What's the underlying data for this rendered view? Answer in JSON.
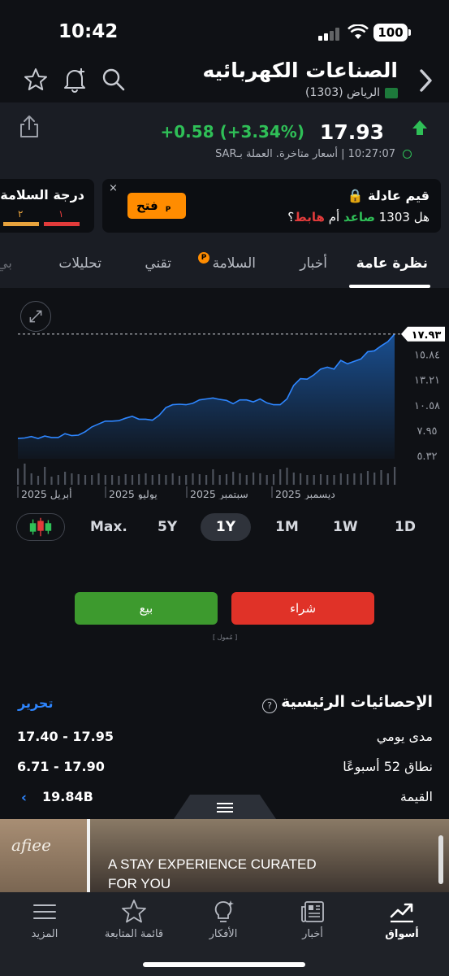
{
  "status_bar": {
    "time": "10:42",
    "battery": "100"
  },
  "header": {
    "title": "الصناعات الكهربائيه",
    "exchange": "الرياض (1303)"
  },
  "quote": {
    "price": "17.93",
    "change": "+0.58 (+3.34%)",
    "meta": "10:27:07 | أسعار متاخرة. العملة بـSAR",
    "direction_color": "#2fbf57"
  },
  "fair_value_card": {
    "title": "قيم عادلة",
    "question_prefix": "هل 1303",
    "up_word": "صاعد",
    "or_word": "أم",
    "down_word": "هابط",
    "question_suffix": "؟",
    "open_button": "فتح",
    "close": "×"
  },
  "safety_card": {
    "title": "درجة السلامة",
    "scores": [
      "١",
      "٢"
    ]
  },
  "tabs": [
    {
      "label": "نظرة عامة",
      "active": true
    },
    {
      "label": "أخبار",
      "active": false
    },
    {
      "label": "السلامة",
      "active": false
    },
    {
      "label": "تقني",
      "active": false
    },
    {
      "label": "تحليلات",
      "active": false
    },
    {
      "label": "بي",
      "active": false
    }
  ],
  "chart_data": {
    "type": "area",
    "current_price_label": "١٧.٩٣",
    "y_ticks": [
      "١٥.٨٤",
      "١٣.٢١",
      "١٠.٥٨",
      "٧.٩٥",
      "٥.٣٢"
    ],
    "y_tick_values": [
      15.84,
      13.21,
      10.58,
      7.95,
      5.32
    ],
    "x_labels": [
      "أبريل 2025",
      "يوليو 2025",
      "سبتمبر 2025",
      "ديسمبر 2025"
    ],
    "ylim": [
      5.0,
      18.5
    ],
    "series": [
      {
        "values": [
          7.1,
          7.15,
          7.3,
          7.1,
          7.35,
          7.2,
          7.2,
          7.6,
          7.4,
          7.45,
          7.8,
          8.3,
          8.6,
          8.9,
          8.9,
          8.95,
          9.2,
          9.4,
          9.1,
          9.1,
          9.0,
          9.5,
          10.3,
          10.6,
          10.65,
          10.6,
          10.75,
          11.1,
          11.2,
          11.3,
          11.15,
          11.05,
          10.7,
          11.1,
          11.1,
          10.9,
          11.2,
          10.8,
          10.6,
          10.6,
          11.2,
          12.6,
          13.3,
          13.25,
          13.7,
          14.3,
          14.5,
          14.3,
          15.2,
          14.85,
          15.1,
          15.35,
          16.1,
          16.2,
          16.7,
          17.15,
          17.93
        ]
      }
    ],
    "volume": [
      20,
      26,
      14,
      11,
      22,
      10,
      12,
      16,
      14,
      13,
      12,
      12,
      14,
      12,
      12,
      11,
      13,
      12,
      13,
      14,
      12,
      13,
      12,
      14,
      11,
      12,
      14,
      13,
      12,
      19,
      12,
      13,
      16,
      14,
      12,
      15,
      14,
      12,
      13,
      19,
      21,
      15,
      14,
      12,
      12,
      13,
      12,
      12,
      14,
      13,
      14,
      14,
      17,
      15,
      18,
      14,
      22
    ],
    "grid": false,
    "line_color": "#2e86ff"
  },
  "ranges": [
    {
      "label": "Max.",
      "active": false
    },
    {
      "label": "5Y",
      "active": false
    },
    {
      "label": "1Y",
      "active": true
    },
    {
      "label": "1M",
      "active": false
    },
    {
      "label": "1W",
      "active": false
    },
    {
      "label": "1D",
      "active": false
    }
  ],
  "trade": {
    "sell": "بيع",
    "buy": "شراء",
    "sponsored": "[ مُمول ]"
  },
  "stats": {
    "title": "الإحصائيات الرئيسية",
    "edit": "تحرير",
    "help": "?",
    "rows": [
      {
        "label": "مدى يومي",
        "value": "17.40 - 17.95"
      },
      {
        "label": "نطاق 52 أسبوعًا",
        "value": "6.71 - 17.90"
      },
      {
        "label": "القيمة",
        "value": "19.84B"
      }
    ]
  },
  "ad": {
    "headline_1": "A STAY EXPERIENCE CURATED",
    "headline_2": "FOR YOU",
    "logo": "afiee"
  },
  "bottom_nav": [
    {
      "label": "المزيد",
      "icon": "menu-icon",
      "active": false
    },
    {
      "label": "قائمة المتابعة",
      "icon": "star-icon",
      "active": false
    },
    {
      "label": "الأفكار",
      "icon": "lightbulb-icon",
      "active": false
    },
    {
      "label": "أخبار",
      "icon": "newspaper-icon",
      "active": false
    },
    {
      "label": "أسواق",
      "icon": "chart-up-icon",
      "active": true
    }
  ]
}
